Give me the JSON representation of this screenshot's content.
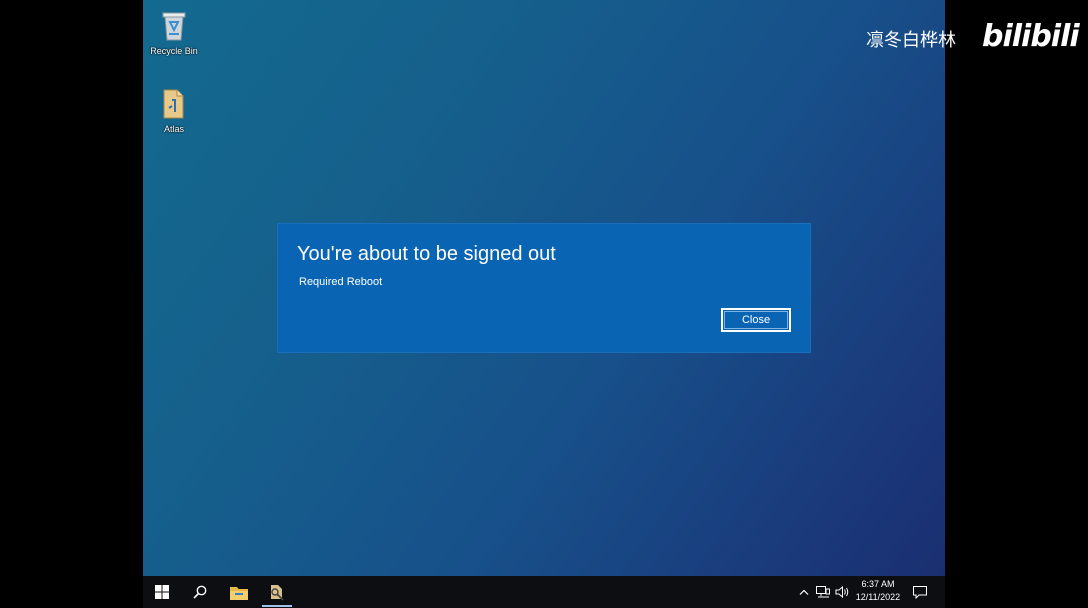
{
  "desktop": {
    "icons": [
      {
        "label": "Recycle Bin",
        "icon": "recycle-bin-icon"
      },
      {
        "label": "Atlas",
        "icon": "folder-icon"
      }
    ]
  },
  "dialog": {
    "title": "You're about to be signed out",
    "message": "Required Reboot",
    "close_label": "Close",
    "background": "#0a64b4"
  },
  "taskbar": {
    "start": "windows-start-icon",
    "search": "search-icon",
    "apps": [
      "file-explorer-icon",
      "atlas-app-icon"
    ],
    "tray": [
      "chevron-up-icon",
      "network-icon",
      "volume-icon"
    ],
    "clock": {
      "time": "6:37 AM",
      "date": "12/11/2022"
    },
    "notifications": "action-center-icon"
  },
  "watermark": {
    "user": "凛冬白桦林",
    "logo": "bilibili"
  }
}
